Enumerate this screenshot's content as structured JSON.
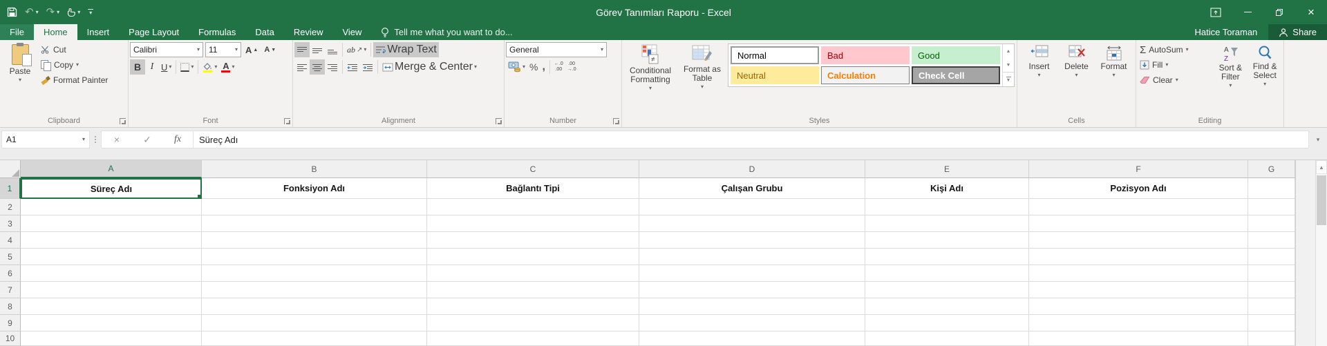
{
  "titlebar": {
    "title": "Görev Tanımları Raporu - Excel"
  },
  "tabs": [
    "File",
    "Home",
    "Insert",
    "Page Layout",
    "Formulas",
    "Data",
    "Review",
    "View"
  ],
  "active_tab": "Home",
  "tell_me": "Tell me what you want to do...",
  "user": {
    "name": "Hatice Toraman"
  },
  "share_label": "Share",
  "icons": {
    "dropdown": "▾",
    "undo": "↶",
    "redo": "↷",
    "close": "×",
    "cancel": "×",
    "check": "✓",
    "scroll_up": "▲",
    "letter_a": "A",
    "orientation_arrow": "↗"
  },
  "ribbon": {
    "clipboard": {
      "label": "Clipboard",
      "paste": "Paste",
      "cut": "Cut",
      "copy": "Copy",
      "format_painter": "Format Painter"
    },
    "font": {
      "label": "Font",
      "family": "Calibri",
      "size": "11",
      "bold": "B",
      "italic": "I",
      "underline": "U"
    },
    "alignment": {
      "label": "Alignment",
      "orientation": "ab",
      "wrap_text": "Wrap Text",
      "merge_center": "Merge & Center"
    },
    "number": {
      "label": "Number",
      "format": "General",
      "percent": "%",
      "comma": ",",
      "increase_decimal": "←.0\n.00",
      "decrease_decimal": ".00\n→.0"
    },
    "styles": {
      "label": "Styles",
      "conditional_formatting": "Conditional Formatting",
      "format_as_table": "Format as Table",
      "gallery": [
        {
          "name": "Normal",
          "bg": "#ffffff",
          "fg": "#000000"
        },
        {
          "name": "Bad",
          "bg": "#ffc7ce",
          "fg": "#9c0006"
        },
        {
          "name": "Good",
          "bg": "#c6efce",
          "fg": "#006100"
        },
        {
          "name": "Neutral",
          "bg": "#ffeb9c",
          "fg": "#9c6500"
        },
        {
          "name": "Calculation",
          "bg": "#f2f2f2",
          "fg": "#fa7d00"
        },
        {
          "name": "Check Cell",
          "bg": "#a5a5a5",
          "fg": "#ffffff"
        }
      ]
    },
    "cells": {
      "label": "Cells",
      "insert": "Insert",
      "delete": "Delete",
      "format": "Format"
    },
    "editing": {
      "label": "Editing",
      "autosum_glyph": "Σ",
      "autosum": "AutoSum",
      "fill": "Fill",
      "clear": "Clear",
      "sort_filter": "Sort & Filter",
      "find_select": "Find & Select"
    }
  },
  "formula_bar": {
    "name_box": "A1",
    "fx": "fx",
    "formula": "Süreç Adı"
  },
  "sheet": {
    "columns": [
      "A",
      "B",
      "C",
      "D",
      "E",
      "F",
      "G"
    ],
    "rows": [
      "1",
      "2",
      "3",
      "4",
      "5",
      "6",
      "7",
      "8",
      "9",
      "10"
    ],
    "header_cells": [
      "Süreç Adı",
      "Fonksiyon Adı",
      "Bağlantı Tipi",
      "Çalışan Grubu",
      "Kişi Adı",
      "Pozisyon Adı"
    ],
    "selected_cell": "A1",
    "selected_column": "A",
    "selected_row": "1"
  },
  "colors": {
    "excel_green": "#217346",
    "share_button_bg": "#1a5c38",
    "selection_border": "#217346",
    "fill_color_swatch": "#ffff00",
    "font_color_swatch": "#ff0000"
  }
}
